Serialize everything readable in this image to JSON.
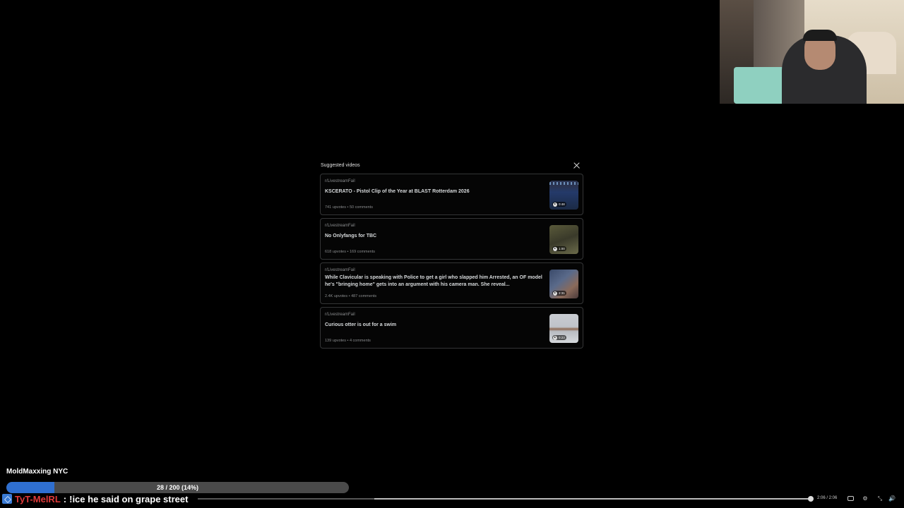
{
  "panel": {
    "title": "Suggested videos",
    "items": [
      {
        "subreddit": "r/LivestreamFail",
        "title": "KSCERATO - Pistol Clip of the Year at BLAST Rotterdam 2026",
        "meta": "741 upvotes • 50 comments",
        "duration": "0:48"
      },
      {
        "subreddit": "r/LivestreamFail",
        "title": "No Onlyfangs for TBC",
        "meta": "618 upvotes • 169 comments",
        "duration": "1:00"
      },
      {
        "subreddit": "r/LivestreamFail",
        "title": "While Clavicular is speaking with Police to get a girl who slapped him Arrested, an OF model he's \"bringing home\" gets into an argument with his camera man. She reveal...",
        "meta": "2.4K upvotes • 487 comments",
        "duration": "2:31"
      },
      {
        "subreddit": "r/LivestreamFail",
        "title": "Curious otter is out for a swim",
        "meta": "139 upvotes • 4 comments",
        "duration": "0:23"
      }
    ]
  },
  "overlay": {
    "channel_name": "MoldMaxxing NYC",
    "goal_text": "28 / 200 (14%)",
    "goal_fraction": 0.14
  },
  "chat": {
    "username": "TyT-MelRL",
    "separator": ":",
    "message": "!ice he said on grape street"
  },
  "player": {
    "time": "2:06 / 2:06"
  }
}
